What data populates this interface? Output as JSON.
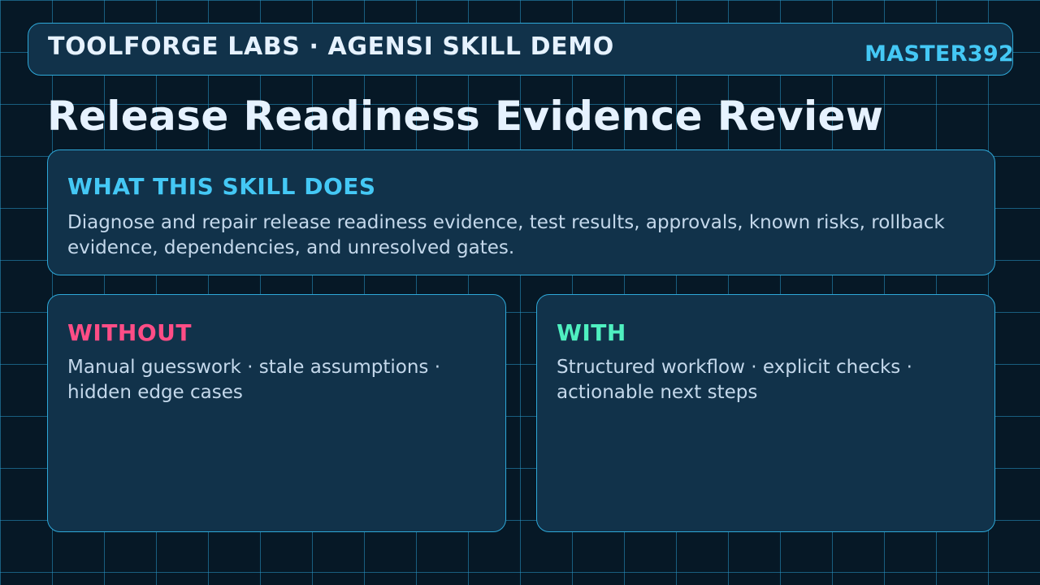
{
  "header": {
    "brand": "TOOLFORGE LABS · AGENSI SKILL DEMO",
    "user_tag": "MASTER392"
  },
  "page_title": "Release Readiness Evidence Review",
  "description_card": {
    "heading": "WHAT THIS SKILL DOES",
    "body": "Diagnose and repair release readiness evidence, test results, approvals, known risks, rollback evidence, dependencies, and unresolved gates."
  },
  "comparison": {
    "without": {
      "heading": "WITHOUT",
      "body": "Manual guesswork · stale assumptions · hidden edge cases"
    },
    "with": {
      "heading": "WITH",
      "body": "Structured workflow · explicit checks · actionable next steps"
    }
  },
  "colors": {
    "background": "#061826",
    "card": "#11324a",
    "border": "#2ea8d8",
    "accent_cyan": "#44c8f5",
    "accent_pink": "#ff4d86",
    "accent_green": "#4ff0c0",
    "title_text": "#e6f2ff",
    "body_text": "#c4d8eb"
  }
}
